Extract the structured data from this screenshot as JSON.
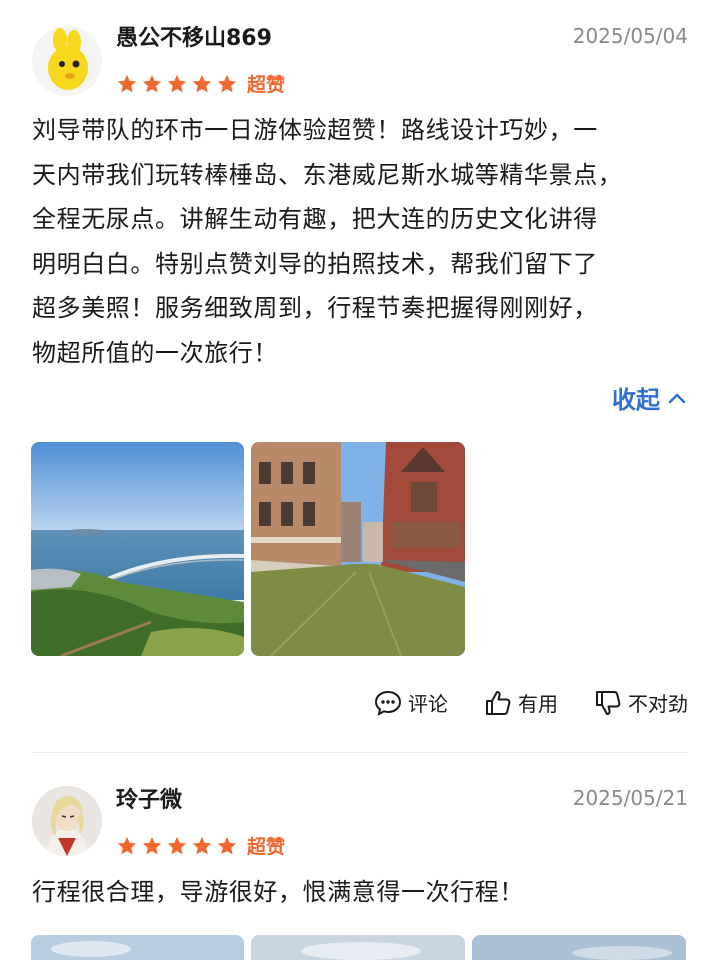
{
  "reviews": [
    {
      "username": "愚公不移山869",
      "date": "2025/05/04",
      "rating": 5,
      "rating_label": "超赞",
      "avatar_icon": "yellow-cartoon-avatar",
      "content_lines": [
        "刘导带队的环市一日游体验超赞！路线设计巧妙，一",
        "天内带我们玩转棒棰岛、东港威尼斯水城等精华景点，",
        "全程无尿点。讲解生动有趣，把大连的历史文化讲得",
        "明明白白。特别点赞刘导的拍照技术，帮我们留下了",
        "超多美照！服务细致周到，行程节奏把握得刚刚好，",
        "物超所值的一次旅行！"
      ],
      "collapse_label": "收起",
      "photos": [
        "coastal-bridge-photo",
        "venice-canal-town-photo"
      ],
      "actions": {
        "comment": "评论",
        "useful": "有用",
        "not_right": "不对劲"
      }
    },
    {
      "username": "玲子微",
      "date": "2025/05/21",
      "rating": 5,
      "rating_label": "超赞",
      "avatar_icon": "anime-character-avatar",
      "content": "行程很合理，导游很好，恨满意得一次行程！"
    }
  ],
  "colors": {
    "star": "#f0682e",
    "accent_blue": "#2f6fd6",
    "date_gray": "#8a8a8a"
  }
}
